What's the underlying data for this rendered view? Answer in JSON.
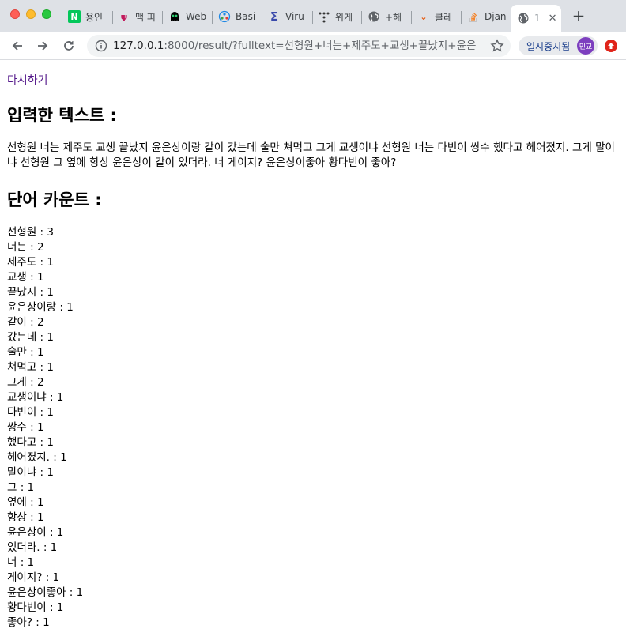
{
  "browser": {
    "tabs": [
      {
        "title": "용인",
        "icon": "naver-icon"
      },
      {
        "title": "맥 피",
        "icon": "flower-icon"
      },
      {
        "title": "Web",
        "icon": "ghost-icon"
      },
      {
        "title": "Basi",
        "icon": "network-icon"
      },
      {
        "title": "Viru",
        "icon": "sigma-icon"
      },
      {
        "title": "위게",
        "icon": "dots-icon"
      },
      {
        "title": "+해",
        "icon": "globe-icon"
      },
      {
        "title": "클레",
        "icon": "bird-icon"
      },
      {
        "title": "Djan",
        "icon": "stackoverflow-icon"
      }
    ],
    "active_tab": {
      "title": "1",
      "icon": "globe-icon"
    },
    "url_host": "127.0.0.1",
    "url_rest": ":8000/result/?fulltext=선형원+너는+제주도+교생+끝났지+윤은상...",
    "paused_label": "일시중지됨",
    "avatar_label": "민교"
  },
  "page": {
    "retry_link": "다시하기",
    "input_heading": "입력한 텍스트 :",
    "input_text": "선형원 너는 제주도 교생 끝났지 윤은상이랑 같이 갔는데 술만 쳐먹고 그게 교생이냐 선형원 너는 다빈이 쌍수 했다고 헤어졌지. 그게 말이냐 선형원 그 옆에 항상 윤은상이 같이 있더라. 너 게이지? 윤은상이좋아 황다빈이 좋아?",
    "count_heading": "단어 카운트 :",
    "word_counts": [
      "선형원 : 3",
      "너는 : 2",
      "제주도 : 1",
      "교생 : 1",
      "끝났지 : 1",
      "윤은상이랑 : 1",
      "같이 : 2",
      "갔는데 : 1",
      "술만 : 1",
      "쳐먹고 : 1",
      "그게 : 2",
      "교생이냐 : 1",
      "다빈이 : 1",
      "쌍수 : 1",
      "했다고 : 1",
      "헤어졌지. : 1",
      "말이냐 : 1",
      "그 : 1",
      "옆에 : 1",
      "항상 : 1",
      "윤은상이 : 1",
      "있더라. : 1",
      "너 : 1",
      "게이지? : 1",
      "윤은상이좋아 : 1",
      "황다빈이 : 1",
      "좋아? : 1"
    ]
  }
}
